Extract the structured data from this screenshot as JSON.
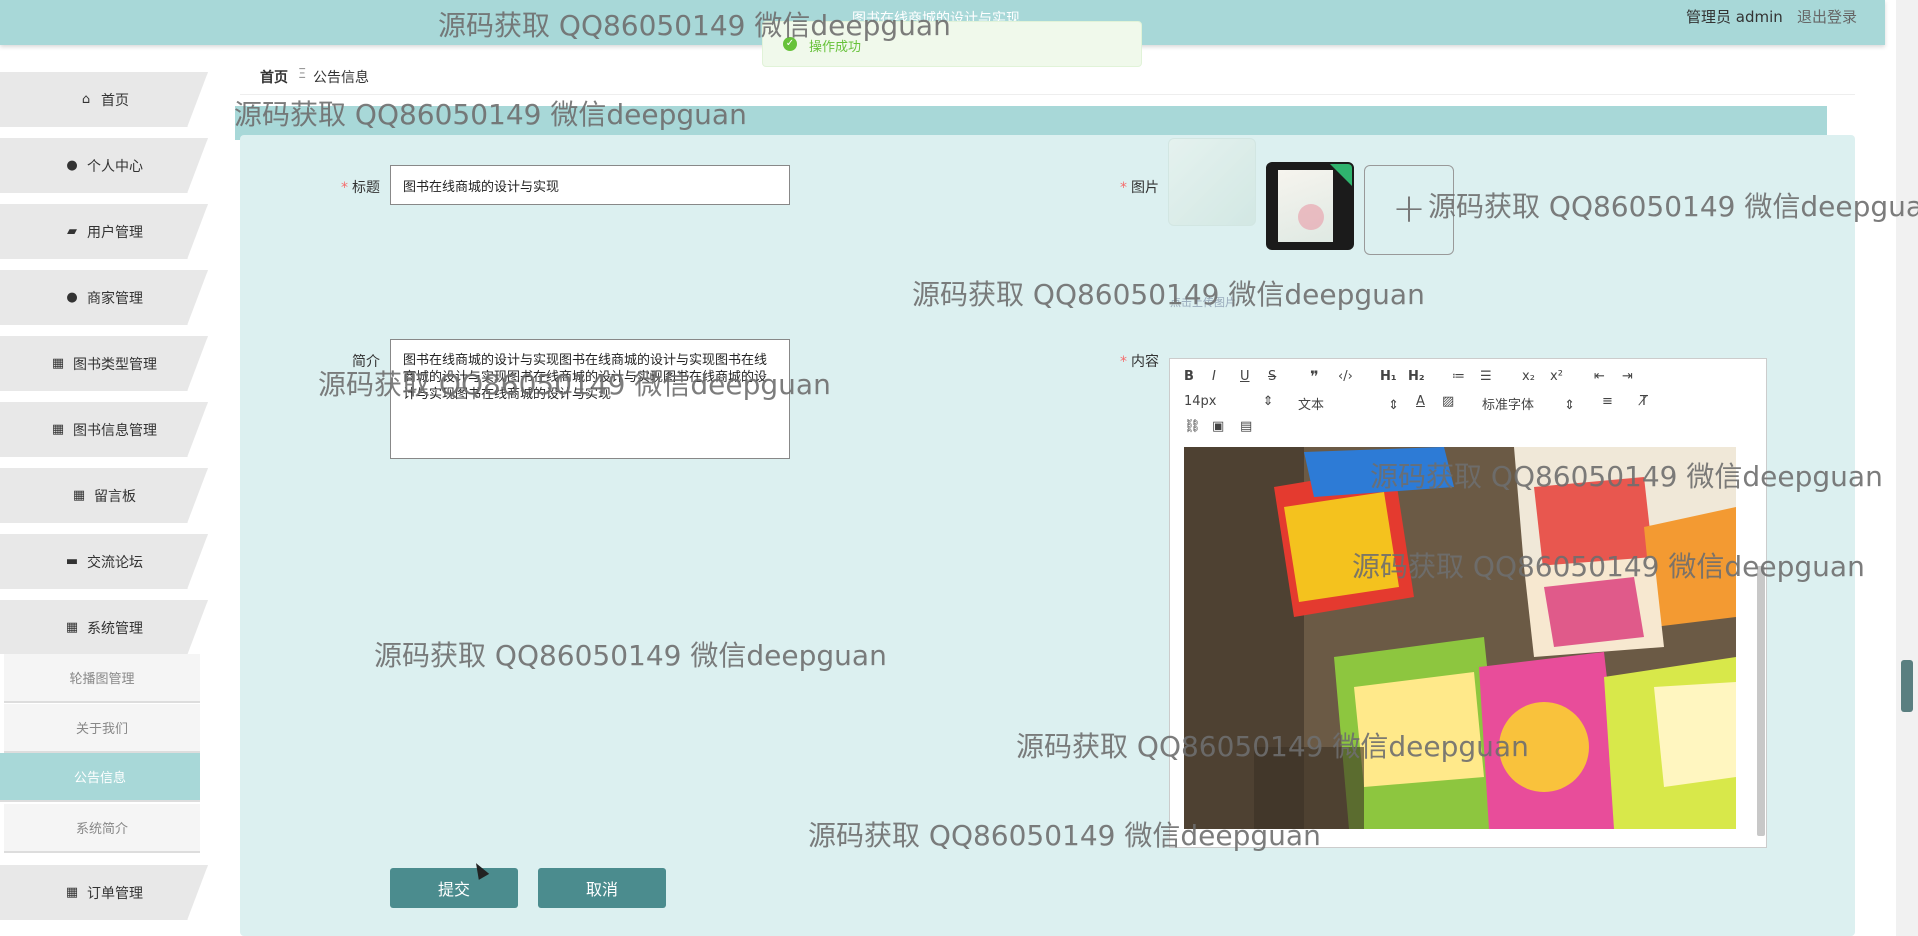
{
  "header": {
    "app_title": "图书在线商城的设计与实现",
    "admin_label": "管理员 admin",
    "logout_label": "退出登录"
  },
  "toast": {
    "message": "操作成功"
  },
  "sidebar": {
    "items": [
      {
        "label": "首页",
        "icon": "home-icon"
      },
      {
        "label": "个人中心",
        "icon": "user-icon"
      },
      {
        "label": "用户管理",
        "icon": "chart-icon"
      },
      {
        "label": "商家管理",
        "icon": "bulb-icon"
      },
      {
        "label": "图书类型管理",
        "icon": "grid-icon"
      },
      {
        "label": "图书信息管理",
        "icon": "grid-icon"
      },
      {
        "label": "留言板",
        "icon": "grid-icon"
      },
      {
        "label": "交流论坛",
        "icon": "briefcase-icon"
      },
      {
        "label": "系统管理",
        "icon": "grid-icon"
      },
      {
        "label": "订单管理",
        "icon": "grid-icon"
      }
    ],
    "sub_items": [
      {
        "label": "轮播图管理"
      },
      {
        "label": "关于我们"
      },
      {
        "label": "公告信息"
      },
      {
        "label": "系统简介"
      }
    ]
  },
  "breadcrumb": {
    "home": "首页",
    "current": "公告信息"
  },
  "form": {
    "title_label": "标题",
    "title_value": "图书在线商城的设计与实现",
    "intro_label": "简介",
    "intro_value": "图书在线商城的设计与实现图书在线商城的设计与实现图书在线商城的设计与实现图书在线商城的设计与实现图书在线商城的设计与实现图书在线商城的设计与实现",
    "image_label": "图片",
    "upload_tip": "点击上传图片",
    "content_label": "内容",
    "submit_label": "提交",
    "cancel_label": "取消"
  },
  "editor": {
    "font_size": "14px",
    "paragraph": "文本",
    "font_family": "标准字体"
  },
  "watermark": "源码获取 QQ86050149 微信deepguan",
  "colors": {
    "topbar": "#a8d8d8",
    "panel": "#dcf0f0",
    "button": "#4b8c8e",
    "success": "#67c23a"
  }
}
